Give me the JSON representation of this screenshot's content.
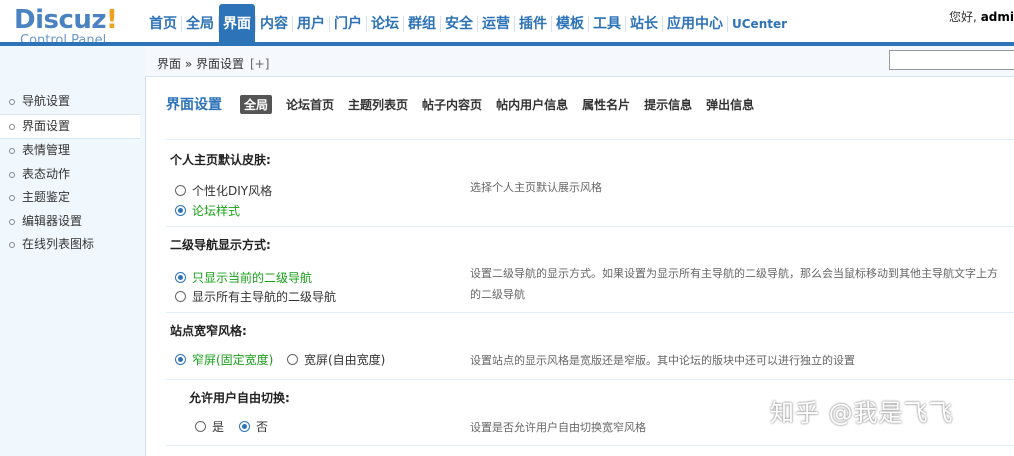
{
  "logo": {
    "main_part1": "Discuz",
    "main_part2": "!",
    "sub": "Control Panel"
  },
  "topnav": [
    "首页",
    "全局",
    "界面",
    "内容",
    "用户",
    "门户",
    "论坛",
    "群组",
    "安全",
    "运营",
    "插件",
    "模板",
    "工具",
    "站长",
    "应用中心",
    "UCenter"
  ],
  "greeting": {
    "prefix": "您好,",
    "user": "admi"
  },
  "breadcrumb": {
    "text": "界面 » 界面设置",
    "add": "[+]"
  },
  "sidebar": [
    "导航设置",
    "界面设置",
    "表情管理",
    "表态动作",
    "主题鉴定",
    "编辑器设置",
    "在线列表图标"
  ],
  "page": {
    "title": "界面设置",
    "tabs": [
      "全局",
      "论坛首页",
      "主题列表页",
      "帖子内容页",
      "帖内用户信息",
      "属性名片",
      "提示信息",
      "弹出信息"
    ]
  },
  "sections": {
    "skin": {
      "title": "个人主页默认皮肤:",
      "opt1": "个性化DIY风格",
      "opt2": "论坛样式",
      "desc": "选择个人主页默认展示风格"
    },
    "subnav": {
      "title": "二级导航显示方式:",
      "opt1": "只显示当前的二级导航",
      "opt2": "显示所有主导航的二级导航",
      "desc1": "设置二级导航的显示方式。如果设置为显示所有主导航的二级导航，那么会当鼠标移动到其他主导航文字上方",
      "desc2": "的二级导航"
    },
    "width": {
      "title": "站点宽窄风格:",
      "opt1": "窄屏(固定宽度)",
      "opt2": "宽屏(自由宽度)",
      "desc": "设置站点的显示风格是宽版还是窄版。其中论坛的版块中还可以进行独立的设置"
    },
    "switch": {
      "title": "允许用户自由切换:",
      "opt1": "是",
      "opt2": "否",
      "desc": "设置是否允许用户自由切换宽窄风格"
    }
  },
  "watermark": "知乎 @我是飞飞",
  "colors": {
    "accent": "#2d73b7",
    "selected_option": "#18a018"
  }
}
